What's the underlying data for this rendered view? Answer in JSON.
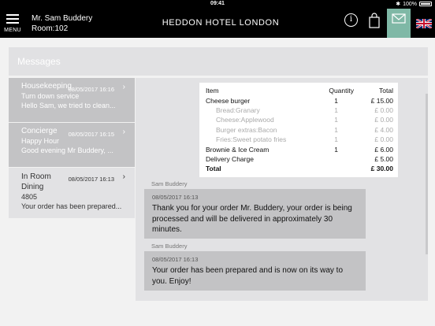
{
  "status_bar": {
    "time": "09:41",
    "battery": "100%"
  },
  "header": {
    "menu_label": "MENU",
    "guest_name": "Mr. Sam Buddery",
    "room": "Room:102",
    "hotel_name": "HEDDON HOTEL LONDON",
    "info_label": "i",
    "mail_color": "#7fb8a6"
  },
  "messages": {
    "title": "Messages",
    "items": [
      {
        "subject": "Housekeeping",
        "date": "08/05/2017 16:16",
        "line1": "Turn down service",
        "line2": "Hello Sam, we tried to clean..."
      },
      {
        "subject": "Concierge",
        "date": "08/05/2017 16:15",
        "line1": "Happy Hour",
        "line2": "Good evening Mr Buddery, ..."
      },
      {
        "subject": "In Room Dining",
        "date": "08/05/2017 16:13",
        "line1": "4805",
        "line2": "Your order has been prepared..."
      }
    ]
  },
  "order": {
    "headers": {
      "item": "Item",
      "quantity": "Quantity",
      "total": "Total"
    },
    "rows": [
      {
        "item": "Cheese burger",
        "qty": "1",
        "total": "£ 15.00"
      },
      {
        "item": "Bread:Granary",
        "qty": "1",
        "total": "£ 0.00"
      },
      {
        "item": "Cheese:Applewood",
        "qty": "1",
        "total": "£ 0.00"
      },
      {
        "item": "Burger extras:Bacon",
        "qty": "1",
        "total": "£ 4.00"
      },
      {
        "item": "Fries:Sweet potato fries",
        "qty": "1",
        "total": "£ 0.00"
      },
      {
        "item": "Brownie & Ice Cream",
        "qty": "1",
        "total": "£ 6.00"
      },
      {
        "item": "Delivery Charge",
        "qty": "",
        "total": "£ 5.00"
      },
      {
        "item": "Total",
        "qty": "",
        "total": "£ 30.00"
      }
    ]
  },
  "conversation": [
    {
      "sender": "Sam Buddery",
      "date": "08/05/2017 16:13",
      "text": "Thank you for your order Mr. Buddery, your order is being processed and will be delivered in approximately 30 minutes."
    },
    {
      "sender": "Sam Buddery",
      "date": "08/05/2017 16:13",
      "text": "Your order has been prepared and is now on its way to you. Enjoy!"
    }
  ]
}
